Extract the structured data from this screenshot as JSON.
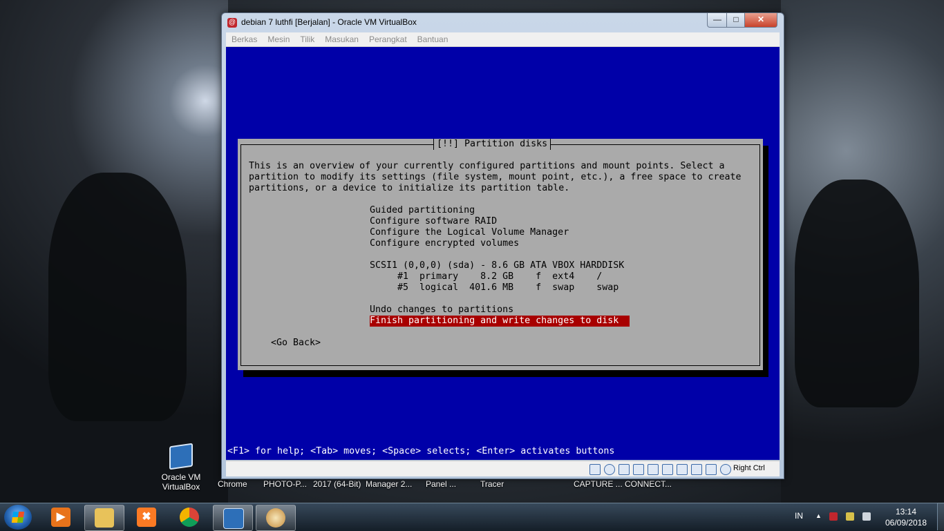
{
  "window": {
    "title": "debian 7 luthfi [Berjalan] - Oracle VM VirtualBox",
    "icon_text": "@",
    "min_glyph": "—",
    "max_glyph": "□",
    "close_glyph": "✕"
  },
  "menu": [
    "Berkas",
    "Mesin",
    "Tilik",
    "Masukan",
    "Perangkat",
    "Bantuan"
  ],
  "installer": {
    "dialog_title": "[!!] Partition disks",
    "intro": [
      "This is an overview of your currently configured partitions and mount points. Select a",
      "partition to modify its settings (file system, mount point, etc.), a free space to create",
      "partitions, or a device to initialize its partition table."
    ],
    "items": [
      "Guided partitioning",
      "Configure software RAID",
      "Configure the Logical Volume Manager",
      "Configure encrypted volumes",
      "",
      "SCSI1 (0,0,0) (sda) - 8.6 GB ATA VBOX HARDDISK",
      "     #1  primary    8.2 GB    f  ext4    /",
      "     #5  logical  401.6 MB    f  swap    swap",
      "",
      "Undo changes to partitions"
    ],
    "selected_item": "Finish partitioning and write changes to disk",
    "go_back": "<Go Back>",
    "help": "<F1> for help; <Tab> moves; <Space> selects; <Enter> activates buttons"
  },
  "statusbar": {
    "host_key": "Right Ctrl"
  },
  "desktop": {
    "icon_label_line1": "Oracle VM",
    "icon_label_line2": "VirtualBox",
    "hidden_labels": [
      "Chrome",
      "PHOTO-P...",
      "2017 (64-Bit)",
      "Manager 2...",
      "Panel ...",
      "Tracer",
      "CAPTURE ...",
      "CONNECT..."
    ]
  },
  "taskbar": {
    "language": "IN",
    "time": "13:14",
    "date": "06/09/2018"
  }
}
